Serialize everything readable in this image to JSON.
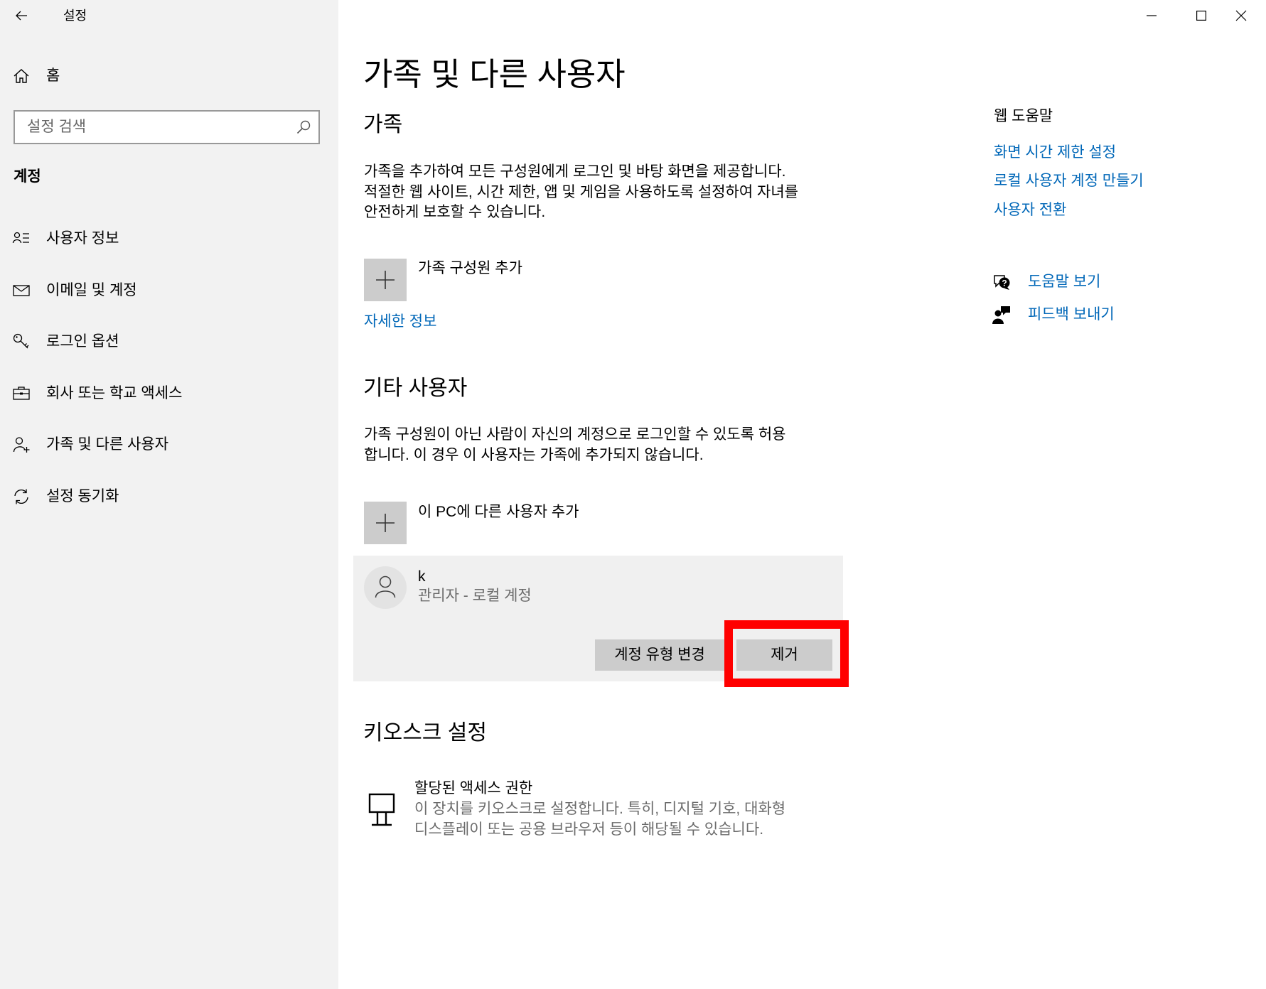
{
  "app": {
    "title": "설정"
  },
  "window_controls": {
    "minimize_icon": "minimize-icon",
    "maximize_icon": "maximize-icon",
    "close_icon": "close-icon"
  },
  "sidebar": {
    "back_icon": "back-arrow-icon",
    "home": {
      "label": "홈",
      "icon": "home-icon"
    },
    "search": {
      "placeholder": "설정 검색",
      "icon": "search-icon"
    },
    "section_title": "계정",
    "items": [
      {
        "label": "사용자 정보",
        "icon": "user-info-icon"
      },
      {
        "label": "이메일 및 계정",
        "icon": "email-icon"
      },
      {
        "label": "로그인 옵션",
        "icon": "key-icon"
      },
      {
        "label": "회사 또는 학교 액세스",
        "icon": "briefcase-icon"
      },
      {
        "label": "가족 및 다른 사용자",
        "icon": "add-person-icon"
      },
      {
        "label": "설정 동기화",
        "icon": "sync-icon"
      }
    ]
  },
  "main": {
    "title": "가족 및 다른 사용자",
    "family": {
      "heading": "가족",
      "description_lines": [
        "가족을 추가하여 모든 구성원에게 로그인 및 바탕 화면을 제공합니다.",
        "적절한 웹 사이트, 시간 제한, 앱 및 게임을 사용하도록 설정하여 자녀를",
        "안전하게 보호할 수 있습니다."
      ],
      "add_member_label": "가족 구성원 추가",
      "learn_more_link": "자세한 정보"
    },
    "other_users": {
      "heading": "기타 사용자",
      "description_lines": [
        "가족 구성원이 아닌 사람이 자신의 계정으로 로그인할 수 있도록 허용",
        "합니다. 이 경우 이 사용자는 가족에 추가되지 않습니다."
      ],
      "add_user_label": "이 PC에 다른 사용자 추가",
      "accounts": [
        {
          "name": "k",
          "type": "관리자 - 로컬 계정",
          "change_type_button": "계정 유형 변경",
          "remove_button": "제거"
        }
      ]
    },
    "kiosk": {
      "heading": "키오스크 설정",
      "title": "할당된 액세스 권한",
      "icon": "kiosk-icon",
      "description_lines": [
        "이 장치를 키오스크로 설정합니다. 특히, 디지털 기호, 대화형",
        "디스플레이 또는 공용 브라우저 등이 해당될 수 있습니다."
      ]
    }
  },
  "help_panel": {
    "heading": "웹 도움말",
    "links": [
      "화면 시간 제한 설정",
      "로컬 사용자 계정 만들기",
      "사용자 전환"
    ],
    "get_help": {
      "label": "도움말 보기",
      "icon": "help-chat-icon"
    },
    "feedback": {
      "label": "피드백 보내기",
      "icon": "feedback-icon"
    }
  },
  "colors": {
    "accent": "#0067b8",
    "sidebar_background": "#f2f2f2",
    "button": "#cccccc",
    "panel_background": "#f0f0f0",
    "secondary_text": "#6b6b6b",
    "highlight": "#ff0000"
  }
}
